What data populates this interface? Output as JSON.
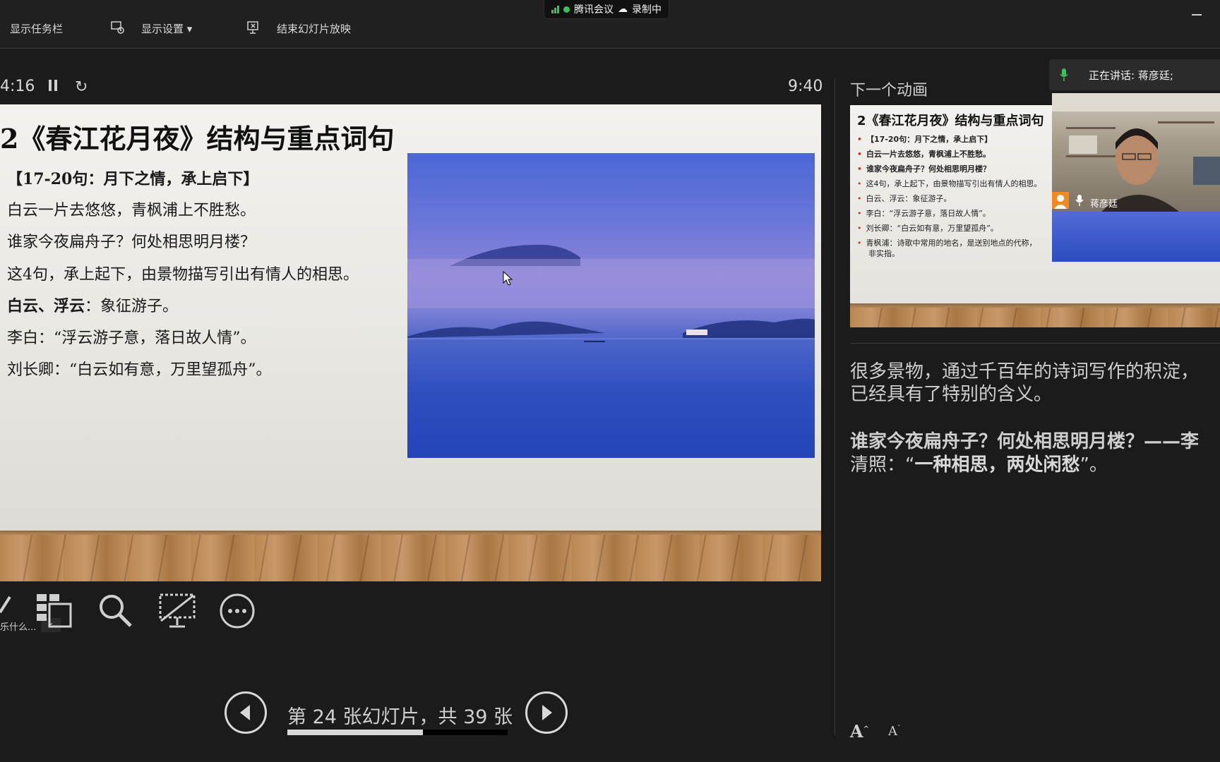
{
  "toolbar": {
    "show_taskbar": "显示任务栏",
    "display_settings": "显示设置 ▾",
    "end_slideshow": "结束幻灯片放映"
  },
  "meeting": {
    "app_name": "腾讯会议",
    "recording": "录制中"
  },
  "timer": {
    "elapsed": "4:16",
    "clock": "9:40"
  },
  "slide": {
    "title": "2《春江花月夜》结构与重点词句",
    "lines": [
      "【17-20句：月下之情，承上启下】",
      "白云一片去悠悠，青枫浦上不胜愁。",
      "谁家今夜扁舟子？何处相思明月楼？",
      "这4句，承上起下，由景物描写引出有情人的相思。",
      "白云、浮云",
      "：象征游子。",
      "李白：“浮云游子意，落日故人情”。",
      "刘长卿：“白云如有意，万里望孤舟”。"
    ]
  },
  "tools": {
    "pen_hint": "乐什么..."
  },
  "navigation": {
    "counter": "第 24 张幻灯片，共 39 张",
    "current": 24,
    "total": 39
  },
  "next_panel": {
    "label": "下一个动画",
    "mini_title": "2《春江花月夜》结构与重点词句",
    "mini_lines": [
      "【17-20句：月下之情，承上启下】",
      "白云一片去悠悠，青枫浦上不胜愁。",
      "谁家今夜扁舟子？何处相思明月楼？",
      "这4句，承上起下，由景物描写引出有情人的相思。",
      "白云、浮云：象征游子。",
      "李白：“浮云游子意，落日故人情”。",
      "刘长卿：“白云如有意，万里望孤舟”。",
      "青枫浦：诗歌中常用的地名，是送别地点的代称，",
      "非实指。"
    ]
  },
  "notes": {
    "line1": "很多景物，通过千百年的诗词写作的积淀，",
    "line2": "已经具有了特别的含义。",
    "line3": "谁家今夜扁舟子？何处相思明月楼？——李",
    "line4_a": "清照：“",
    "line4_b": "一种相思，两处闲愁",
    "line4_c": "”。"
  },
  "font_controls": {
    "increase": "A",
    "decrease": "A"
  },
  "speaker": {
    "label": "正在讲话: 蒋彦廷;",
    "video_name": "蒋彦廷"
  },
  "colors": {
    "background": "#1b1b1b",
    "accent_green": "#3fbf5a",
    "bullet_red": "#c03a2b"
  }
}
